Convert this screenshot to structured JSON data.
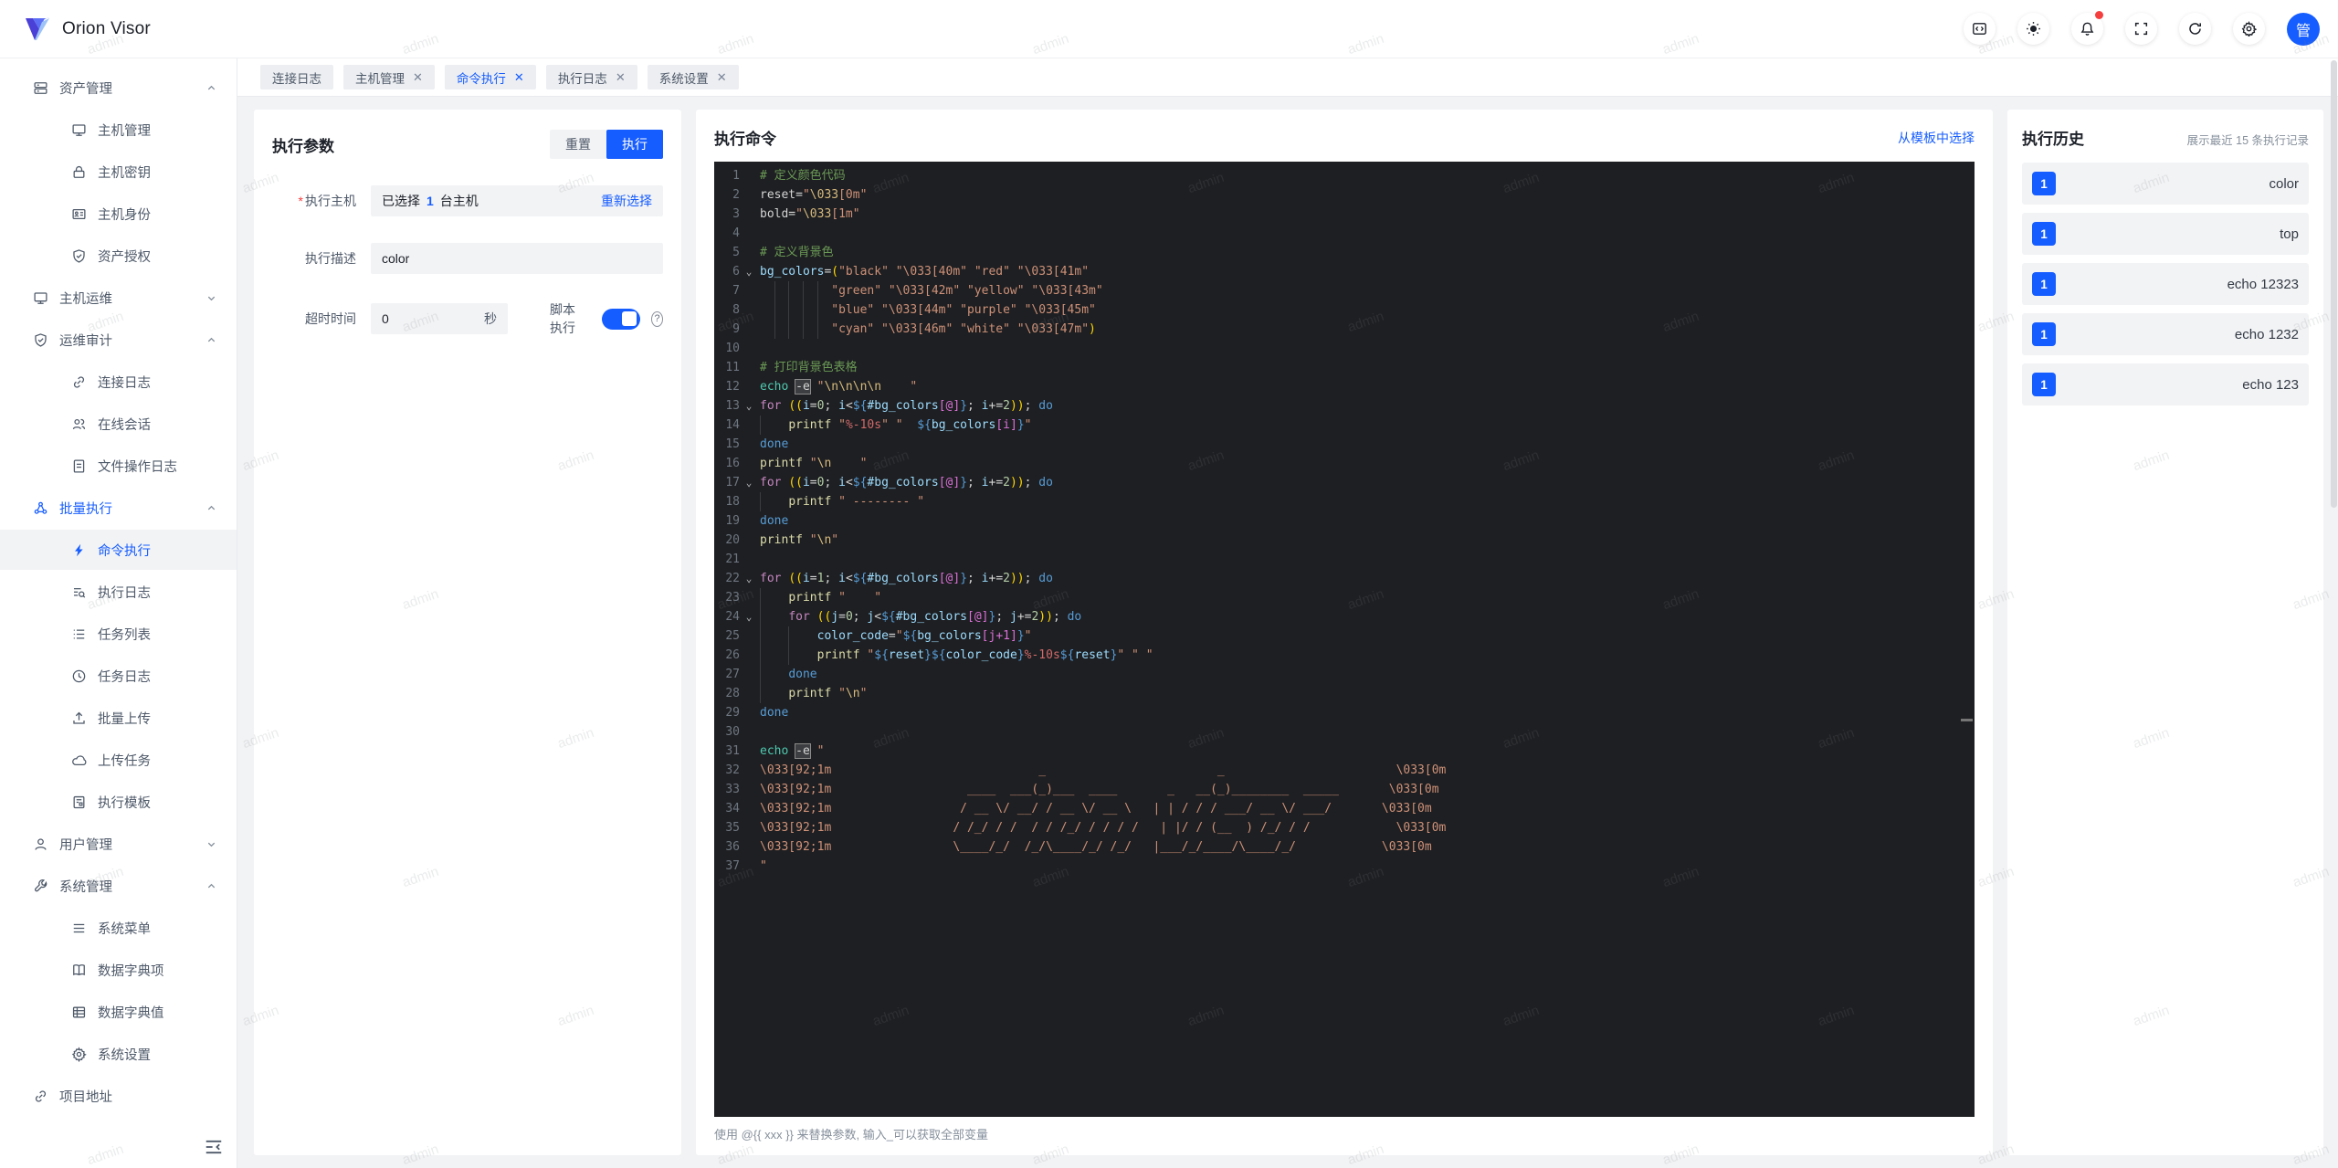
{
  "app": {
    "name": "Orion Visor",
    "avatar_text": "管"
  },
  "watermark": "admin",
  "header_icons": [
    "code-window-icon",
    "theme-icon",
    "notification-bell-icon",
    "fullscreen-icon",
    "refresh-icon",
    "settings-gear-icon"
  ],
  "sidebar": {
    "items": [
      {
        "label": "资产管理",
        "level": 1,
        "icon": "server",
        "chev": "up"
      },
      {
        "label": "主机管理",
        "level": 2,
        "icon": "monitor"
      },
      {
        "label": "主机密钥",
        "level": 2,
        "icon": "lock"
      },
      {
        "label": "主机身份",
        "level": 2,
        "icon": "idcard"
      },
      {
        "label": "资产授权",
        "level": 2,
        "icon": "shield"
      },
      {
        "label": "主机运维",
        "level": 1,
        "icon": "monitor",
        "chev": "down"
      },
      {
        "label": "运维审计",
        "level": 1,
        "icon": "shield",
        "chev": "up"
      },
      {
        "label": "连接日志",
        "level": 2,
        "icon": "link"
      },
      {
        "label": "在线会话",
        "level": 2,
        "icon": "users"
      },
      {
        "label": "文件操作日志",
        "level": 2,
        "icon": "doc"
      },
      {
        "label": "批量执行",
        "level": 1,
        "icon": "nodes",
        "chev": "up",
        "parentActive": true
      },
      {
        "label": "命令执行",
        "level": 2,
        "icon": "bolt",
        "selected": true
      },
      {
        "label": "执行日志",
        "level": 2,
        "icon": "logsearch"
      },
      {
        "label": "任务列表",
        "level": 2,
        "icon": "list"
      },
      {
        "label": "任务日志",
        "level": 2,
        "icon": "clock"
      },
      {
        "label": "批量上传",
        "level": 2,
        "icon": "upload"
      },
      {
        "label": "上传任务",
        "level": 2,
        "icon": "cloud"
      },
      {
        "label": "执行模板",
        "level": 2,
        "icon": "template"
      },
      {
        "label": "用户管理",
        "level": 1,
        "icon": "user",
        "chev": "down"
      },
      {
        "label": "系统管理",
        "level": 1,
        "icon": "wrench",
        "chev": "up"
      },
      {
        "label": "系统菜单",
        "level": 2,
        "icon": "menu"
      },
      {
        "label": "数据字典项",
        "level": 2,
        "icon": "book"
      },
      {
        "label": "数据字典值",
        "level": 2,
        "icon": "table"
      },
      {
        "label": "系统设置",
        "level": 2,
        "icon": "gear"
      },
      {
        "label": "项目地址",
        "level": 1,
        "icon": "chain"
      }
    ]
  },
  "tabs": [
    {
      "label": "连接日志",
      "closable": false,
      "active": false
    },
    {
      "label": "主机管理",
      "closable": true,
      "active": false
    },
    {
      "label": "命令执行",
      "closable": true,
      "active": true
    },
    {
      "label": "执行日志",
      "closable": true,
      "active": false
    },
    {
      "label": "系统设置",
      "closable": true,
      "active": false
    }
  ],
  "params_panel": {
    "title": "执行参数",
    "reset_label": "重置",
    "run_label": "执行",
    "host_label": "执行主机",
    "host_selected_prefix": "已选择",
    "host_selected_count": "1",
    "host_selected_suffix": "台主机",
    "reselect_label": "重新选择",
    "desc_label": "执行描述",
    "desc_value": "color",
    "timeout_label": "超时时间",
    "timeout_value": "0",
    "timeout_unit": "秒",
    "script_label": "脚本执行",
    "script_on": true,
    "help_glyph": "?"
  },
  "command_panel": {
    "title": "执行命令",
    "template_link": "从模板中选择",
    "hint": "使用 @{{ xxx }} 来替换参数, 输入_可以获取全部变量",
    "editor_lines": [
      {
        "seg": [
          [
            "cm",
            "# 定义颜色代码"
          ]
        ]
      },
      {
        "seg": [
          [
            "pl",
            "reset="
          ],
          [
            "st",
            "\""
          ],
          [
            "esc",
            "\\033"
          ],
          [
            "st",
            "[0m\""
          ]
        ]
      },
      {
        "seg": [
          [
            "pl",
            "bold="
          ],
          [
            "st",
            "\""
          ],
          [
            "esc",
            "\\033"
          ],
          [
            "st",
            "[1m\""
          ]
        ]
      },
      {
        "seg": []
      },
      {
        "seg": [
          [
            "cm",
            "# 定义背景色"
          ]
        ]
      },
      {
        "fold": 1,
        "seg": [
          [
            "vr",
            "bg_colors"
          ],
          [
            "pl",
            "="
          ],
          [
            "pr",
            "("
          ],
          [
            "st",
            "\"black\" \"\\033[40m\" \"red\" \"\\033[41m\""
          ]
        ]
      },
      {
        "guides": [
          2,
          4,
          6,
          8
        ],
        "seg": [
          [
            "st",
            "          \"green\" \"\\033[42m\" \"yellow\" \"\\033[43m\""
          ]
        ]
      },
      {
        "guides": [
          2,
          4,
          6,
          8
        ],
        "seg": [
          [
            "st",
            "          \"blue\" \"\\033[44m\" \"purple\" \"\\033[45m\""
          ]
        ]
      },
      {
        "guides": [
          2,
          4,
          6,
          8
        ],
        "seg": [
          [
            "st",
            "          \"cyan\" \"\\033[46m\" \"white\" \"\\033[47m\""
          ],
          [
            "pr",
            ")"
          ]
        ]
      },
      {
        "seg": []
      },
      {
        "seg": [
          [
            "cm",
            "# 打印背景色表格"
          ]
        ]
      },
      {
        "seg": [
          [
            "bi",
            "echo"
          ],
          [
            "pl",
            " "
          ],
          [
            "hl",
            "-e"
          ],
          [
            "pl",
            " "
          ],
          [
            "st",
            "\""
          ],
          [
            "esc",
            "\\n\\n\\n\\n"
          ],
          [
            "st",
            "    \""
          ]
        ]
      },
      {
        "fold": 1,
        "seg": [
          [
            "kw",
            "for"
          ],
          [
            "pl",
            " "
          ],
          [
            "pr",
            "(("
          ],
          [
            "vr",
            "i"
          ],
          [
            "pl",
            "="
          ],
          [
            "nu",
            "0"
          ],
          [
            "pl",
            "; "
          ],
          [
            "vr",
            "i"
          ],
          [
            "pl",
            "<"
          ],
          [
            "kb",
            "${"
          ],
          [
            "vr",
            "#bg_colors"
          ],
          [
            "br",
            "[@]"
          ],
          [
            "kb",
            "}"
          ],
          [
            "pl",
            "; "
          ],
          [
            "vr",
            "i"
          ],
          [
            "pl",
            "+="
          ],
          [
            "nu",
            "2"
          ],
          [
            "pr",
            "))"
          ],
          [
            "pl",
            "; "
          ],
          [
            "kb",
            "do"
          ]
        ]
      },
      {
        "guides": [
          0
        ],
        "seg": [
          [
            "pl",
            "    "
          ],
          [
            "fn",
            "printf"
          ],
          [
            "pl",
            " "
          ],
          [
            "st",
            "\""
          ],
          [
            "fmt",
            "%-10s"
          ],
          [
            "st",
            "\" \"  "
          ],
          [
            "kb",
            "${"
          ],
          [
            "vr",
            "bg_colors"
          ],
          [
            "br",
            "[i]"
          ],
          [
            "kb",
            "}"
          ],
          [
            "st",
            "\""
          ]
        ]
      },
      {
        "seg": [
          [
            "kb",
            "done"
          ]
        ]
      },
      {
        "seg": [
          [
            "fn",
            "printf"
          ],
          [
            "pl",
            " "
          ],
          [
            "st",
            "\""
          ],
          [
            "esc",
            "\\n"
          ],
          [
            "st",
            "    \""
          ]
        ]
      },
      {
        "fold": 1,
        "seg": [
          [
            "kw",
            "for"
          ],
          [
            "pl",
            " "
          ],
          [
            "pr",
            "(("
          ],
          [
            "vr",
            "i"
          ],
          [
            "pl",
            "="
          ],
          [
            "nu",
            "0"
          ],
          [
            "pl",
            "; "
          ],
          [
            "vr",
            "i"
          ],
          [
            "pl",
            "<"
          ],
          [
            "kb",
            "${"
          ],
          [
            "vr",
            "#bg_colors"
          ],
          [
            "br",
            "[@]"
          ],
          [
            "kb",
            "}"
          ],
          [
            "pl",
            "; "
          ],
          [
            "vr",
            "i"
          ],
          [
            "pl",
            "+="
          ],
          [
            "nu",
            "2"
          ],
          [
            "pr",
            "))"
          ],
          [
            "pl",
            "; "
          ],
          [
            "kb",
            "do"
          ]
        ]
      },
      {
        "guides": [
          0
        ],
        "seg": [
          [
            "pl",
            "    "
          ],
          [
            "fn",
            "printf"
          ],
          [
            "pl",
            " "
          ],
          [
            "st",
            "\" -------- \""
          ]
        ]
      },
      {
        "seg": [
          [
            "kb",
            "done"
          ]
        ]
      },
      {
        "seg": [
          [
            "fn",
            "printf"
          ],
          [
            "pl",
            " "
          ],
          [
            "st",
            "\""
          ],
          [
            "esc",
            "\\n"
          ],
          [
            "st",
            "\""
          ]
        ]
      },
      {
        "seg": []
      },
      {
        "fold": 1,
        "seg": [
          [
            "kw",
            "for"
          ],
          [
            "pl",
            " "
          ],
          [
            "pr",
            "(("
          ],
          [
            "vr",
            "i"
          ],
          [
            "pl",
            "="
          ],
          [
            "nu",
            "1"
          ],
          [
            "pl",
            "; "
          ],
          [
            "vr",
            "i"
          ],
          [
            "pl",
            "<"
          ],
          [
            "kb",
            "${"
          ],
          [
            "vr",
            "#bg_colors"
          ],
          [
            "br",
            "[@]"
          ],
          [
            "kb",
            "}"
          ],
          [
            "pl",
            "; "
          ],
          [
            "vr",
            "i"
          ],
          [
            "pl",
            "+="
          ],
          [
            "nu",
            "2"
          ],
          [
            "pr",
            "))"
          ],
          [
            "pl",
            "; "
          ],
          [
            "kb",
            "do"
          ]
        ]
      },
      {
        "guides": [
          0
        ],
        "seg": [
          [
            "pl",
            "    "
          ],
          [
            "fn",
            "printf"
          ],
          [
            "pl",
            " "
          ],
          [
            "st",
            "\"    \""
          ]
        ]
      },
      {
        "fold": 1,
        "guides": [
          0
        ],
        "seg": [
          [
            "pl",
            "    "
          ],
          [
            "kw",
            "for"
          ],
          [
            "pl",
            " "
          ],
          [
            "pr",
            "(("
          ],
          [
            "vr",
            "j"
          ],
          [
            "pl",
            "="
          ],
          [
            "nu",
            "0"
          ],
          [
            "pl",
            "; "
          ],
          [
            "vr",
            "j"
          ],
          [
            "pl",
            "<"
          ],
          [
            "kb",
            "${"
          ],
          [
            "vr",
            "#bg_colors"
          ],
          [
            "br",
            "[@]"
          ],
          [
            "kb",
            "}"
          ],
          [
            "pl",
            "; "
          ],
          [
            "vr",
            "j"
          ],
          [
            "pl",
            "+="
          ],
          [
            "nu",
            "2"
          ],
          [
            "pr",
            "))"
          ],
          [
            "pl",
            "; "
          ],
          [
            "kb",
            "do"
          ]
        ]
      },
      {
        "guides": [
          0,
          4
        ],
        "seg": [
          [
            "pl",
            "        "
          ],
          [
            "vr",
            "color_code"
          ],
          [
            "pl",
            "="
          ],
          [
            "st",
            "\""
          ],
          [
            "kb",
            "${"
          ],
          [
            "vr",
            "bg_colors"
          ],
          [
            "br",
            "[j+1]"
          ],
          [
            "kb",
            "}"
          ],
          [
            "st",
            "\""
          ]
        ]
      },
      {
        "guides": [
          0,
          4
        ],
        "seg": [
          [
            "pl",
            "        "
          ],
          [
            "fn",
            "printf"
          ],
          [
            "pl",
            " "
          ],
          [
            "st",
            "\""
          ],
          [
            "kb",
            "${"
          ],
          [
            "vr",
            "reset"
          ],
          [
            "kb",
            "}"
          ],
          [
            "kb",
            "${"
          ],
          [
            "vr",
            "color_code"
          ],
          [
            "kb",
            "}"
          ],
          [
            "fmt",
            "%-10s"
          ],
          [
            "kb",
            "${"
          ],
          [
            "vr",
            "reset"
          ],
          [
            "kb",
            "}"
          ],
          [
            "st",
            "\" \" \""
          ]
        ]
      },
      {
        "guides": [
          0
        ],
        "seg": [
          [
            "pl",
            "    "
          ],
          [
            "kb",
            "done"
          ]
        ]
      },
      {
        "guides": [
          0
        ],
        "seg": [
          [
            "pl",
            "    "
          ],
          [
            "fn",
            "printf"
          ],
          [
            "pl",
            " "
          ],
          [
            "st",
            "\""
          ],
          [
            "esc",
            "\\n"
          ],
          [
            "st",
            "\""
          ]
        ]
      },
      {
        "seg": [
          [
            "kb",
            "done"
          ]
        ]
      },
      {
        "seg": []
      },
      {
        "seg": [
          [
            "bi",
            "echo"
          ],
          [
            "pl",
            " "
          ],
          [
            "hl",
            "-e"
          ],
          [
            "pl",
            " "
          ],
          [
            "st",
            "\""
          ]
        ]
      },
      {
        "seg": [
          [
            "st",
            "\\033[92;1m                             _                        _                        \\033[0m"
          ]
        ]
      },
      {
        "seg": [
          [
            "st",
            "\\033[92;1m                   ____  ___(_)___  ____       _   __(_)________  _____       \\033[0m"
          ]
        ]
      },
      {
        "seg": [
          [
            "st",
            "\\033[92;1m                  / __ \\/ __/ / __ \\/ __ \\   | | / / / ___/ __ \\/ ___/       \\033[0m"
          ]
        ]
      },
      {
        "seg": [
          [
            "st",
            "\\033[92;1m                 / /_/ / /  / / /_/ / / / /   | |/ / (__  ) /_/ / /            \\033[0m"
          ]
        ]
      },
      {
        "seg": [
          [
            "st",
            "\\033[92;1m                 \\____/_/  /_/\\____/_/ /_/   |___/_/____/\\____/_/            \\033[0m"
          ]
        ]
      },
      {
        "seg": [
          [
            "st",
            "\""
          ]
        ]
      }
    ]
  },
  "history_panel": {
    "title": "执行历史",
    "note": "展示最近 15 条执行记录",
    "items": [
      {
        "count": "1",
        "label": "color"
      },
      {
        "count": "1",
        "label": "top"
      },
      {
        "count": "1",
        "label": "echo 12323"
      },
      {
        "count": "1",
        "label": "echo 1232"
      },
      {
        "count": "1",
        "label": "echo 123"
      }
    ]
  },
  "colors": {
    "primary": "#165dff",
    "editor_bg": "#1e1f22",
    "page_bg": "#f2f3f5"
  }
}
